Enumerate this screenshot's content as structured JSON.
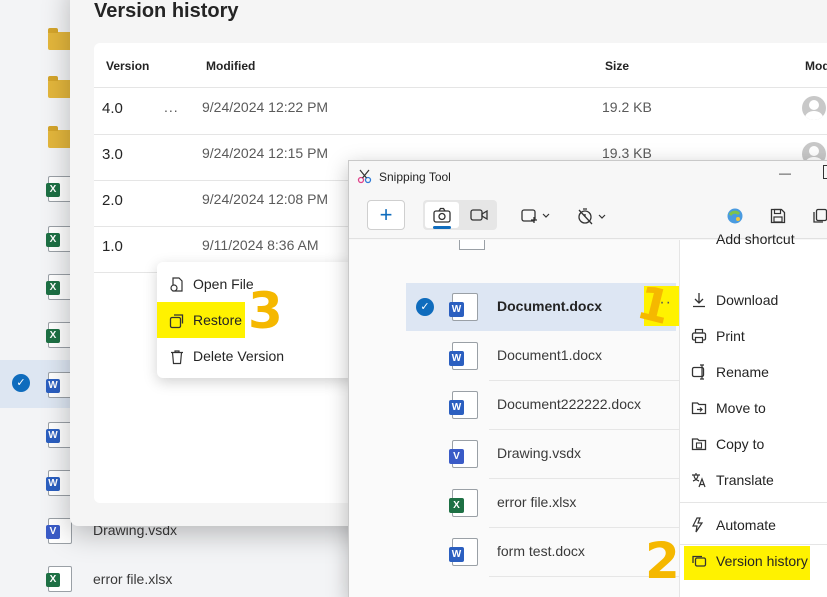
{
  "background": {
    "files": [
      {
        "type": "folder",
        "name": ""
      },
      {
        "type": "folder",
        "name": ""
      },
      {
        "type": "folder",
        "name": ""
      },
      {
        "type": "excel",
        "name": ""
      },
      {
        "type": "excel",
        "name": ""
      },
      {
        "type": "excel",
        "name": ""
      },
      {
        "type": "excel",
        "name": ""
      },
      {
        "type": "word",
        "name": ""
      },
      {
        "type": "word",
        "name": ""
      },
      {
        "type": "word",
        "name": ""
      },
      {
        "type": "visio",
        "name": "Drawing.vsdx"
      },
      {
        "type": "excel",
        "name": "error file.xlsx"
      }
    ],
    "check_mark": "✓"
  },
  "version_history": {
    "title": "Version history",
    "columns": {
      "version": "Version",
      "modified": "Modified",
      "size": "Size",
      "modified_by": "Mod"
    },
    "more_label": "...",
    "rows": [
      {
        "version": "4.0",
        "modified": "9/24/2024 12:22 PM",
        "size": "19.2 KB"
      },
      {
        "version": "3.0",
        "modified": "9/24/2024 12:15 PM",
        "size": "19.3 KB"
      },
      {
        "version": "2.0",
        "modified": "9/24/2024 12:08 PM",
        "size": ""
      },
      {
        "version": "1.0",
        "modified": "9/11/2024 8:36 AM",
        "size": ""
      }
    ]
  },
  "context_menu": {
    "items": [
      {
        "label": "Open File",
        "icon": "open-file-icon"
      },
      {
        "label": "Restore",
        "icon": "restore-icon"
      },
      {
        "label": "Delete Version",
        "icon": "trash-icon"
      }
    ]
  },
  "snipping_tool": {
    "title": "Snipping Tool",
    "new_label": "+",
    "minimize_label": "—",
    "files": [
      {
        "name": "Document.docx",
        "type": "word",
        "selected": true
      },
      {
        "name": "Document1.docx",
        "type": "word"
      },
      {
        "name": "Document222222.docx",
        "type": "word"
      },
      {
        "name": "Drawing.vsdx",
        "type": "visio"
      },
      {
        "name": "error file.xlsx",
        "type": "excel"
      },
      {
        "name": "form test.docx",
        "type": "word"
      }
    ],
    "row_more_label": "···",
    "menu": {
      "partial_top": "Add shortcut",
      "items": [
        {
          "label": "Download",
          "icon": "download-icon"
        },
        {
          "label": "Print",
          "icon": "print-icon"
        },
        {
          "label": "Rename",
          "icon": "rename-icon"
        },
        {
          "label": "Move to",
          "icon": "move-to-icon"
        },
        {
          "label": "Copy to",
          "icon": "copy-to-icon"
        },
        {
          "label": "Translate",
          "icon": "translate-icon"
        },
        {
          "label": "Automate",
          "icon": "automate-icon"
        },
        {
          "label": "Version history",
          "icon": "version-history-icon"
        }
      ]
    }
  },
  "annotations": {
    "one": "1",
    "two": "2",
    "three": "3"
  },
  "colors": {
    "highlight": "#fff200",
    "annotation": "#f5b800",
    "accent": "#0f6cbd"
  }
}
